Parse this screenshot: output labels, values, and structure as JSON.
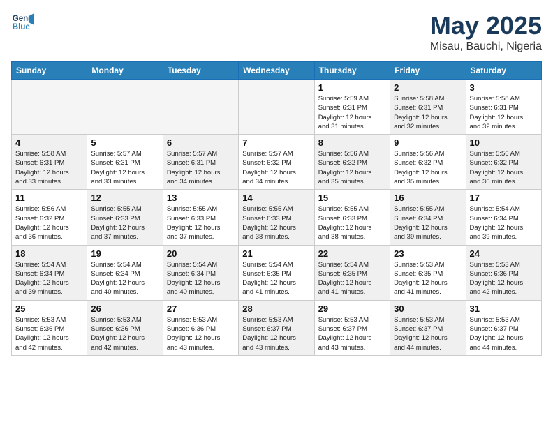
{
  "logo": {
    "line1": "General",
    "line2": "Blue"
  },
  "title": "May 2025",
  "subtitle": "Misau, Bauchi, Nigeria",
  "weekdays": [
    "Sunday",
    "Monday",
    "Tuesday",
    "Wednesday",
    "Thursday",
    "Friday",
    "Saturday"
  ],
  "weeks": [
    [
      {
        "day": "",
        "info": "",
        "empty": true
      },
      {
        "day": "",
        "info": "",
        "empty": true
      },
      {
        "day": "",
        "info": "",
        "empty": true
      },
      {
        "day": "",
        "info": "",
        "empty": true
      },
      {
        "day": "1",
        "info": "Sunrise: 5:59 AM\nSunset: 6:31 PM\nDaylight: 12 hours\nand 31 minutes."
      },
      {
        "day": "2",
        "info": "Sunrise: 5:58 AM\nSunset: 6:31 PM\nDaylight: 12 hours\nand 32 minutes."
      },
      {
        "day": "3",
        "info": "Sunrise: 5:58 AM\nSunset: 6:31 PM\nDaylight: 12 hours\nand 32 minutes."
      }
    ],
    [
      {
        "day": "4",
        "info": "Sunrise: 5:58 AM\nSunset: 6:31 PM\nDaylight: 12 hours\nand 33 minutes."
      },
      {
        "day": "5",
        "info": "Sunrise: 5:57 AM\nSunset: 6:31 PM\nDaylight: 12 hours\nand 33 minutes."
      },
      {
        "day": "6",
        "info": "Sunrise: 5:57 AM\nSunset: 6:31 PM\nDaylight: 12 hours\nand 34 minutes."
      },
      {
        "day": "7",
        "info": "Sunrise: 5:57 AM\nSunset: 6:32 PM\nDaylight: 12 hours\nand 34 minutes."
      },
      {
        "day": "8",
        "info": "Sunrise: 5:56 AM\nSunset: 6:32 PM\nDaylight: 12 hours\nand 35 minutes."
      },
      {
        "day": "9",
        "info": "Sunrise: 5:56 AM\nSunset: 6:32 PM\nDaylight: 12 hours\nand 35 minutes."
      },
      {
        "day": "10",
        "info": "Sunrise: 5:56 AM\nSunset: 6:32 PM\nDaylight: 12 hours\nand 36 minutes."
      }
    ],
    [
      {
        "day": "11",
        "info": "Sunrise: 5:56 AM\nSunset: 6:32 PM\nDaylight: 12 hours\nand 36 minutes."
      },
      {
        "day": "12",
        "info": "Sunrise: 5:55 AM\nSunset: 6:33 PM\nDaylight: 12 hours\nand 37 minutes."
      },
      {
        "day": "13",
        "info": "Sunrise: 5:55 AM\nSunset: 6:33 PM\nDaylight: 12 hours\nand 37 minutes."
      },
      {
        "day": "14",
        "info": "Sunrise: 5:55 AM\nSunset: 6:33 PM\nDaylight: 12 hours\nand 38 minutes."
      },
      {
        "day": "15",
        "info": "Sunrise: 5:55 AM\nSunset: 6:33 PM\nDaylight: 12 hours\nand 38 minutes."
      },
      {
        "day": "16",
        "info": "Sunrise: 5:55 AM\nSunset: 6:34 PM\nDaylight: 12 hours\nand 39 minutes."
      },
      {
        "day": "17",
        "info": "Sunrise: 5:54 AM\nSunset: 6:34 PM\nDaylight: 12 hours\nand 39 minutes."
      }
    ],
    [
      {
        "day": "18",
        "info": "Sunrise: 5:54 AM\nSunset: 6:34 PM\nDaylight: 12 hours\nand 39 minutes."
      },
      {
        "day": "19",
        "info": "Sunrise: 5:54 AM\nSunset: 6:34 PM\nDaylight: 12 hours\nand 40 minutes."
      },
      {
        "day": "20",
        "info": "Sunrise: 5:54 AM\nSunset: 6:34 PM\nDaylight: 12 hours\nand 40 minutes."
      },
      {
        "day": "21",
        "info": "Sunrise: 5:54 AM\nSunset: 6:35 PM\nDaylight: 12 hours\nand 41 minutes."
      },
      {
        "day": "22",
        "info": "Sunrise: 5:54 AM\nSunset: 6:35 PM\nDaylight: 12 hours\nand 41 minutes."
      },
      {
        "day": "23",
        "info": "Sunrise: 5:53 AM\nSunset: 6:35 PM\nDaylight: 12 hours\nand 41 minutes."
      },
      {
        "day": "24",
        "info": "Sunrise: 5:53 AM\nSunset: 6:36 PM\nDaylight: 12 hours\nand 42 minutes."
      }
    ],
    [
      {
        "day": "25",
        "info": "Sunrise: 5:53 AM\nSunset: 6:36 PM\nDaylight: 12 hours\nand 42 minutes."
      },
      {
        "day": "26",
        "info": "Sunrise: 5:53 AM\nSunset: 6:36 PM\nDaylight: 12 hours\nand 42 minutes."
      },
      {
        "day": "27",
        "info": "Sunrise: 5:53 AM\nSunset: 6:36 PM\nDaylight: 12 hours\nand 43 minutes."
      },
      {
        "day": "28",
        "info": "Sunrise: 5:53 AM\nSunset: 6:37 PM\nDaylight: 12 hours\nand 43 minutes."
      },
      {
        "day": "29",
        "info": "Sunrise: 5:53 AM\nSunset: 6:37 PM\nDaylight: 12 hours\nand 43 minutes."
      },
      {
        "day": "30",
        "info": "Sunrise: 5:53 AM\nSunset: 6:37 PM\nDaylight: 12 hours\nand 44 minutes."
      },
      {
        "day": "31",
        "info": "Sunrise: 5:53 AM\nSunset: 6:37 PM\nDaylight: 12 hours\nand 44 minutes."
      }
    ]
  ]
}
